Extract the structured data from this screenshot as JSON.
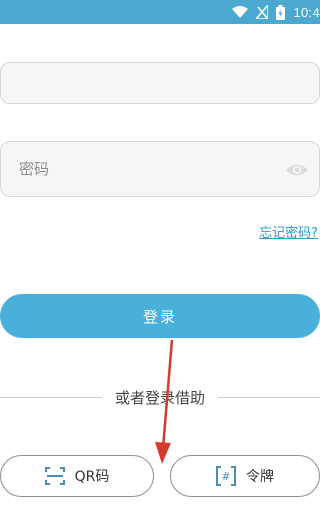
{
  "status_bar": {
    "time": "10:4",
    "icons": [
      "wifi-icon",
      "signal-icon",
      "battery-icon"
    ]
  },
  "form": {
    "username_placeholder": "",
    "password_placeholder": "密码",
    "forgot_password": "忘记密码?",
    "login_label": "登录"
  },
  "alternatives": {
    "divider_text": "或者登录借助",
    "qr_label": "QR码",
    "token_label": "令牌"
  },
  "colors": {
    "accent": "#4ab0da",
    "status_bar": "#4aa8d1",
    "link": "#2e9dc9",
    "annotation_arrow": "#d63b2f"
  }
}
